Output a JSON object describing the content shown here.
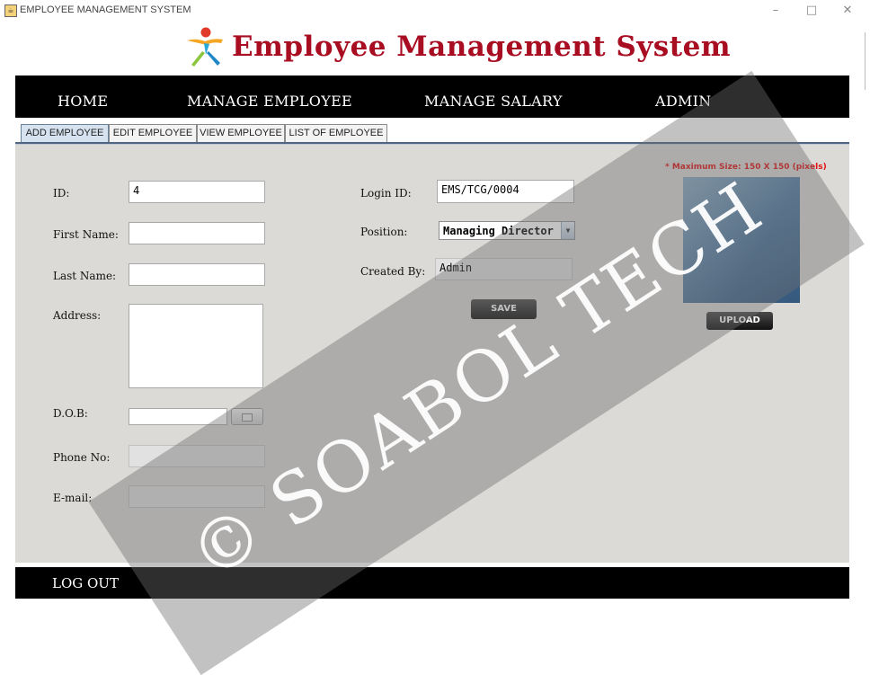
{
  "window": {
    "title": "EMPLOYEE MANAGEMENT SYSTEM",
    "minimize": "–",
    "maximize": "□",
    "close": "✕"
  },
  "header": {
    "title": "Employee Management System",
    "logo_icon": "person-logo-icon",
    "title_color": "#a80d22"
  },
  "nav": {
    "items": [
      {
        "label": "HOME"
      },
      {
        "label": "MANAGE EMPLOYEE"
      },
      {
        "label": "MANAGE SALARY"
      },
      {
        "label": "ADMIN"
      }
    ]
  },
  "tabs": [
    {
      "label": "ADD EMPLOYEE",
      "active": true
    },
    {
      "label": "EDIT EMPLOYEE",
      "active": false
    },
    {
      "label": "VIEW EMPLOYEE",
      "active": false
    },
    {
      "label": "LIST OF EMPLOYEE",
      "active": false
    }
  ],
  "form": {
    "id": {
      "label": "ID:",
      "value": "4"
    },
    "first_name": {
      "label": "First Name:",
      "value": ""
    },
    "last_name": {
      "label": "Last Name:",
      "value": ""
    },
    "address": {
      "label": "Address:",
      "value": ""
    },
    "dob": {
      "label": "D.O.B:",
      "value": "",
      "picker_icon": "calendar-icon"
    },
    "phone": {
      "label": "Phone No:",
      "value": ""
    },
    "email": {
      "label": "E-mail:",
      "value": ""
    },
    "login_id": {
      "label": "Login ID:",
      "value": "EMS/TCG/0004"
    },
    "position": {
      "label": "Position:",
      "value": "Managing Director"
    },
    "created_by": {
      "label": "Created By:",
      "value": "Admin"
    },
    "save_label": "SAVE"
  },
  "photo": {
    "note": "* Maximum Size: 150 X 150 (pixels)",
    "upload_label": "UPLOAD"
  },
  "footer": {
    "logout_label": "LOG OUT"
  },
  "watermark": {
    "text": "© SOABOL TECH"
  }
}
